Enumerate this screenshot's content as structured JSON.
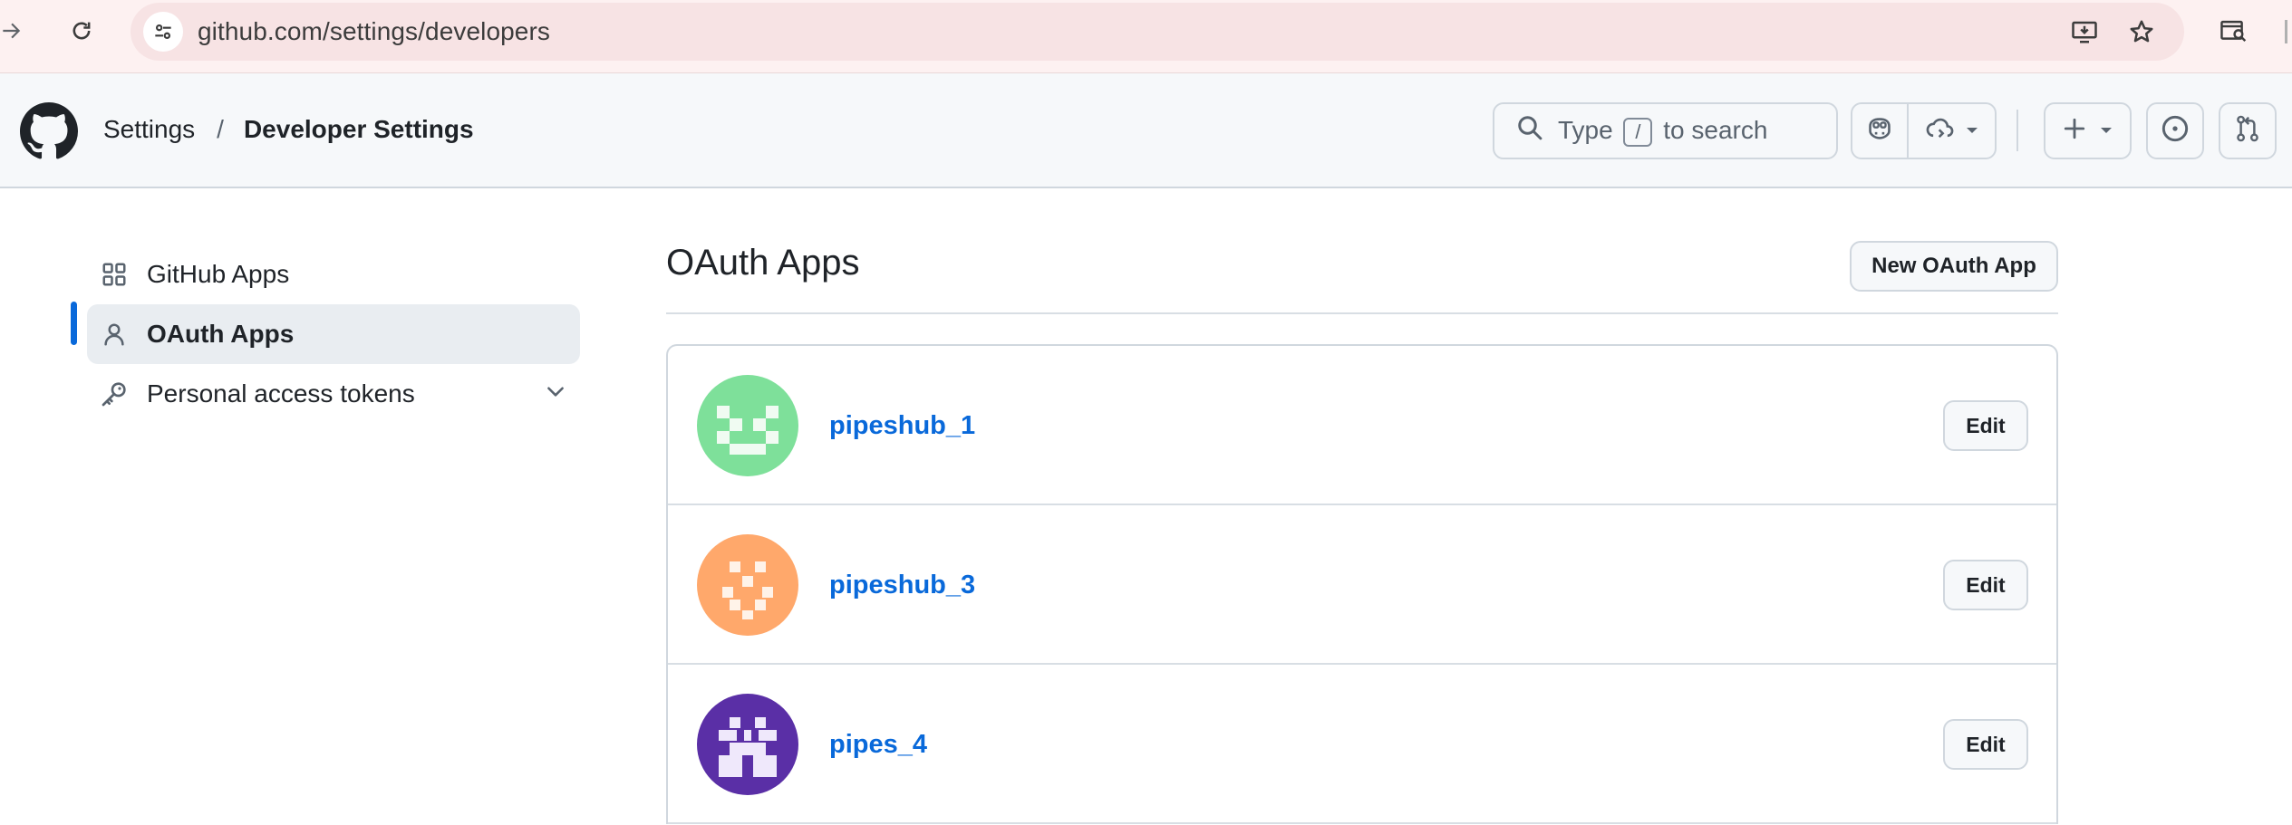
{
  "browser": {
    "url": "github.com/settings/developers",
    "forward_icon": "arrow-right-icon",
    "reload_icon": "reload-icon",
    "site_info_icon": "tune-icon",
    "install_icon": "install-app-icon",
    "bookmark_icon": "star-icon",
    "search_tab_icon": "tab-search-icon"
  },
  "header": {
    "crumb_settings": "Settings",
    "crumb_separator": "/",
    "crumb_current": "Developer Settings",
    "search_prefix": "Type",
    "search_key": "/",
    "search_suffix": "to search"
  },
  "sidebar": {
    "items": [
      {
        "label": "GitHub Apps",
        "icon": "apps-grid-icon",
        "active": false
      },
      {
        "label": "OAuth Apps",
        "icon": "person-icon",
        "active": true
      },
      {
        "label": "Personal access tokens",
        "icon": "key-icon",
        "active": false,
        "expandable": true
      }
    ]
  },
  "main": {
    "title": "OAuth Apps",
    "new_button": "New OAuth App",
    "apps": [
      {
        "name": "pipeshub_1",
        "edit_label": "Edit",
        "avatar_color": "#7ee09a"
      },
      {
        "name": "pipeshub_3",
        "edit_label": "Edit",
        "avatar_color": "#ffa86b"
      },
      {
        "name": "pipes_4",
        "edit_label": "Edit",
        "avatar_color": "#5a2fa6"
      }
    ]
  },
  "colors": {
    "accent": "#0969da",
    "chrome_bg": "#fdf1f1",
    "header_bg": "#f6f8fa"
  }
}
